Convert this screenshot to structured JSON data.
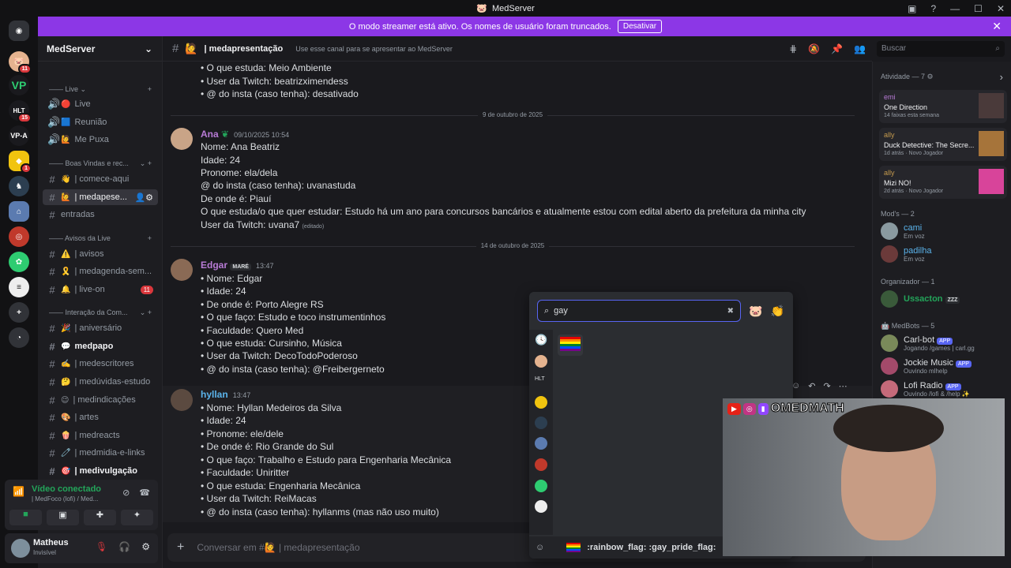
{
  "app": {
    "title": "MedServer"
  },
  "banner": {
    "text": "O modo streamer está ativo. Os nomes de usuário foram truncados.",
    "button": "Desativar"
  },
  "guild_badges": [
    "11",
    "15",
    "1"
  ],
  "server": {
    "name": "MedServer"
  },
  "categories": [
    "Live",
    "Boas Vindas e rec...",
    "Avisos da Live",
    "Interação da Com..."
  ],
  "channels": [
    {
      "name": "Live",
      "emoji": "🔴"
    },
    {
      "name": "Reunião",
      "emoji": "🟦"
    },
    {
      "name": "Me Puxa",
      "emoji": "🙋"
    },
    {
      "name": "| comece-aqui",
      "emoji": "👋"
    },
    {
      "name": "| medapese...",
      "emoji": "🙋"
    },
    {
      "name": "entradas",
      "emoji": ""
    },
    {
      "name": "| avisos",
      "emoji": "⚠️"
    },
    {
      "name": "| medagenda-sem...",
      "emoji": "🎗️"
    },
    {
      "name": "| live-on",
      "emoji": "🔔",
      "count": "11"
    },
    {
      "name": "| aniversário",
      "emoji": "🎉"
    },
    {
      "name": "medpapo",
      "emoji": "💬"
    },
    {
      "name": "| medescritores",
      "emoji": "✍️"
    },
    {
      "name": "| medúvidas-estudo",
      "emoji": "🤔"
    },
    {
      "name": "| medindicações",
      "emoji": "😉"
    },
    {
      "name": "| artes",
      "emoji": "🎨"
    },
    {
      "name": "| medreacts",
      "emoji": "🍿"
    },
    {
      "name": "| medmidia-e-links",
      "emoji": "🧷"
    },
    {
      "name": "| medivulgação",
      "emoji": "🎯"
    }
  ],
  "voice": {
    "status": "Vídeo conectado",
    "channel": "| MedFoco (lofi) / Med..."
  },
  "user": {
    "name": "Matheus",
    "status": "Invisível"
  },
  "channel_header": {
    "name": "| medapresentação",
    "topic": "Use esse canal para se apresentar ao MedServer"
  },
  "search_placeholder": "Buscar",
  "messages_top": [
    "• O que estuda: Meio Ambiente",
    "• User da Twitch: beatrizximendess",
    "• @ do insta (caso tenha): desativado"
  ],
  "date1": "9 de outubro de 2025",
  "msg_ana": {
    "author": "Ana",
    "time": "09/10/2025 10:54",
    "lines": [
      "Nome: Ana Beatriz",
      "Idade: 24",
      "Pronome: ela/dela",
      "@ do insta (caso tenha): uvanastuda",
      "De onde é: Piauí",
      "O que estuda/o que quer estudar: Estudo há um ano para concursos bancários e atualmente estou com edital aberto da prefeitura da minha city",
      "User da Twitch: uvana7"
    ],
    "edited": "(editado)"
  },
  "date2": "14 de outubro de 2025",
  "msg_edgar": {
    "author": "Edgar",
    "tag": "MARÉ",
    "time": "13:47",
    "lines": [
      "• Nome: Edgar",
      "• Idade: 24",
      "• De onde é: Porto Alegre RS",
      "• O que faço: Estudo e toco instrumentinhos",
      "• Faculdade: Quero Med",
      "• O que estuda: Cursinho, Música",
      "• User da Twitch: DecoTodoPoderoso",
      "• @ do insta (caso tenha): @Freibergerneto"
    ]
  },
  "msg_hyllan": {
    "author": "hyllan",
    "time": "13:47",
    "lines": [
      "• Nome: Hyllan Medeiros da Silva",
      "• Idade: 24",
      "• Pronome: ele/dele",
      "• De onde é: Rio Grande do Sul",
      "• O que faço: Trabalho e Estudo para Engenharia Mecânica",
      "• Faculdade: Uniritter",
      "• O que estuda: Engenharia Mecânica",
      "• User da Twitch: ReiMacas",
      "• @ do insta (caso tenha): hyllanms (mas não uso muito)"
    ]
  },
  "composer_placeholder": "Conversar em #🙋 | medapresentação",
  "emoji_picker": {
    "query": "gay",
    "footer": ":rainbow_flag: :gay_pride_flag:"
  },
  "activity": {
    "header": "Atividade — 7",
    "cards": [
      {
        "user": "emi",
        "title": "One Direction",
        "sub": "14 faixas esta semana"
      },
      {
        "user": "ally",
        "title": "Duck Detective: The Secre...",
        "sub": "1d atrás",
        "sub2": "Novo Jogador"
      },
      {
        "user": "ally",
        "title": "Mizi NO!",
        "sub": "2d atrás",
        "sub2": "Novo Jogador"
      }
    ]
  },
  "members": {
    "mods_header": "Mod's — 2",
    "mods": [
      {
        "name": "cami",
        "sub": "Em voz"
      },
      {
        "name": "padilha",
        "sub": "Em voz"
      }
    ],
    "org_header": "Organizador — 1",
    "org": [
      {
        "name": "Ussacton",
        "badge": "ZZZ"
      }
    ],
    "bots_header": "MedBots — 5",
    "bots": [
      {
        "name": "Carl-bot",
        "sub": "Jogando /games | carl.gg"
      },
      {
        "name": "Jockie Music",
        "sub": "Ouvindo mlhelp"
      },
      {
        "name": "Lofi Radio",
        "sub": "Ouvindo /lofi & /help ✨"
      }
    ],
    "app_tag": "APP"
  },
  "webcam": {
    "handle": "OMEDMATH"
  }
}
